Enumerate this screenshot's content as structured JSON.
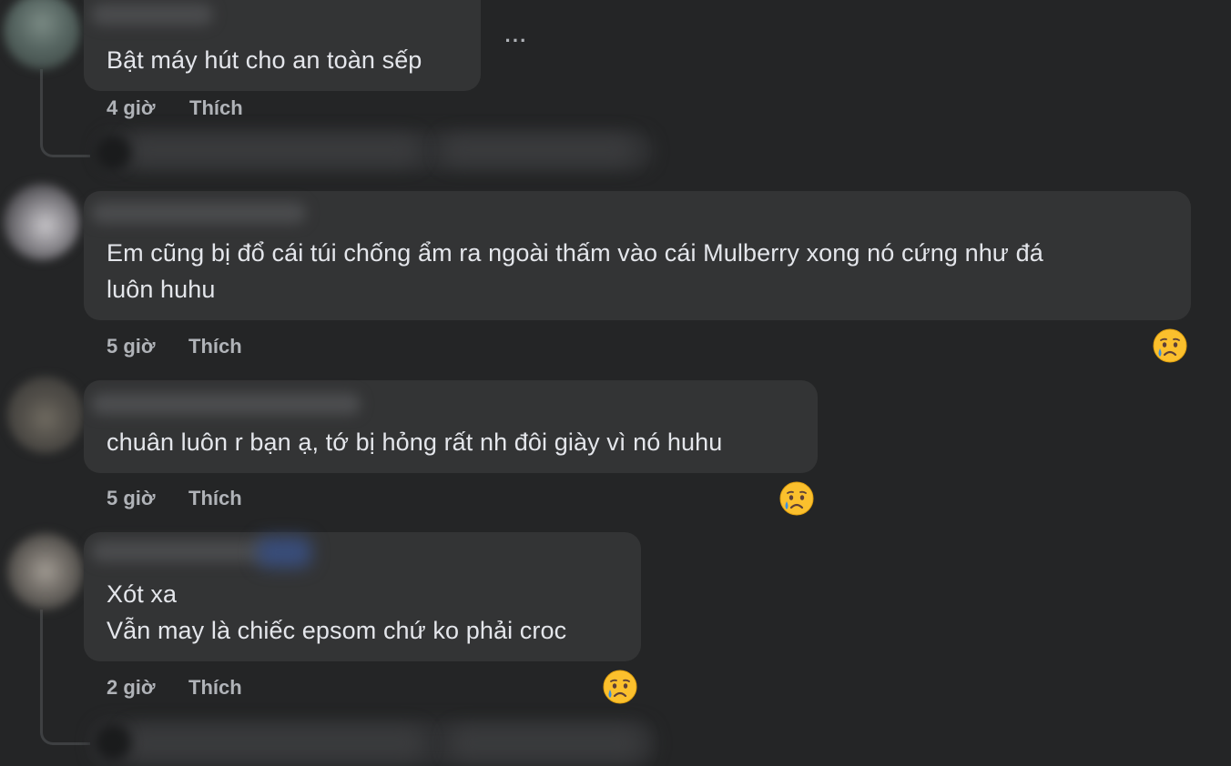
{
  "comments": [
    {
      "text_lines": [
        "Bật máy hút cho an toàn sếp"
      ],
      "time": "4 giờ",
      "like_label": "Thích",
      "has_more_menu": true,
      "more_menu_label": "···",
      "reaction": null
    },
    {
      "text_lines": [
        "Em cũng bị đổ cái túi chống ẩm ra ngoài thấm vào cái Mulberry xong nó cứng như đá",
        "luôn huhu"
      ],
      "time": "5 giờ",
      "like_label": "Thích",
      "reaction": "sad-face"
    },
    {
      "text_lines": [
        "chuân luôn r bạn ạ, tớ bị hỏng rất nh đôi giày vì nó huhu"
      ],
      "time": "5 giờ",
      "like_label": "Thích",
      "reaction": "sad-face"
    },
    {
      "text_lines": [
        "Xót xa",
        "Vẫn may là chiếc epsom chứ ko phải croc"
      ],
      "time": "2 giờ",
      "like_label": "Thích",
      "reaction": "sad-face"
    }
  ],
  "colors": {
    "background": "#242526",
    "bubble": "#333435",
    "text": "#e4e6eb",
    "meta_text": "#b0b3b8",
    "thread_line": "#3e4042",
    "emoji_face": "#fbc02d",
    "emoji_tear": "#3b8fe0"
  }
}
